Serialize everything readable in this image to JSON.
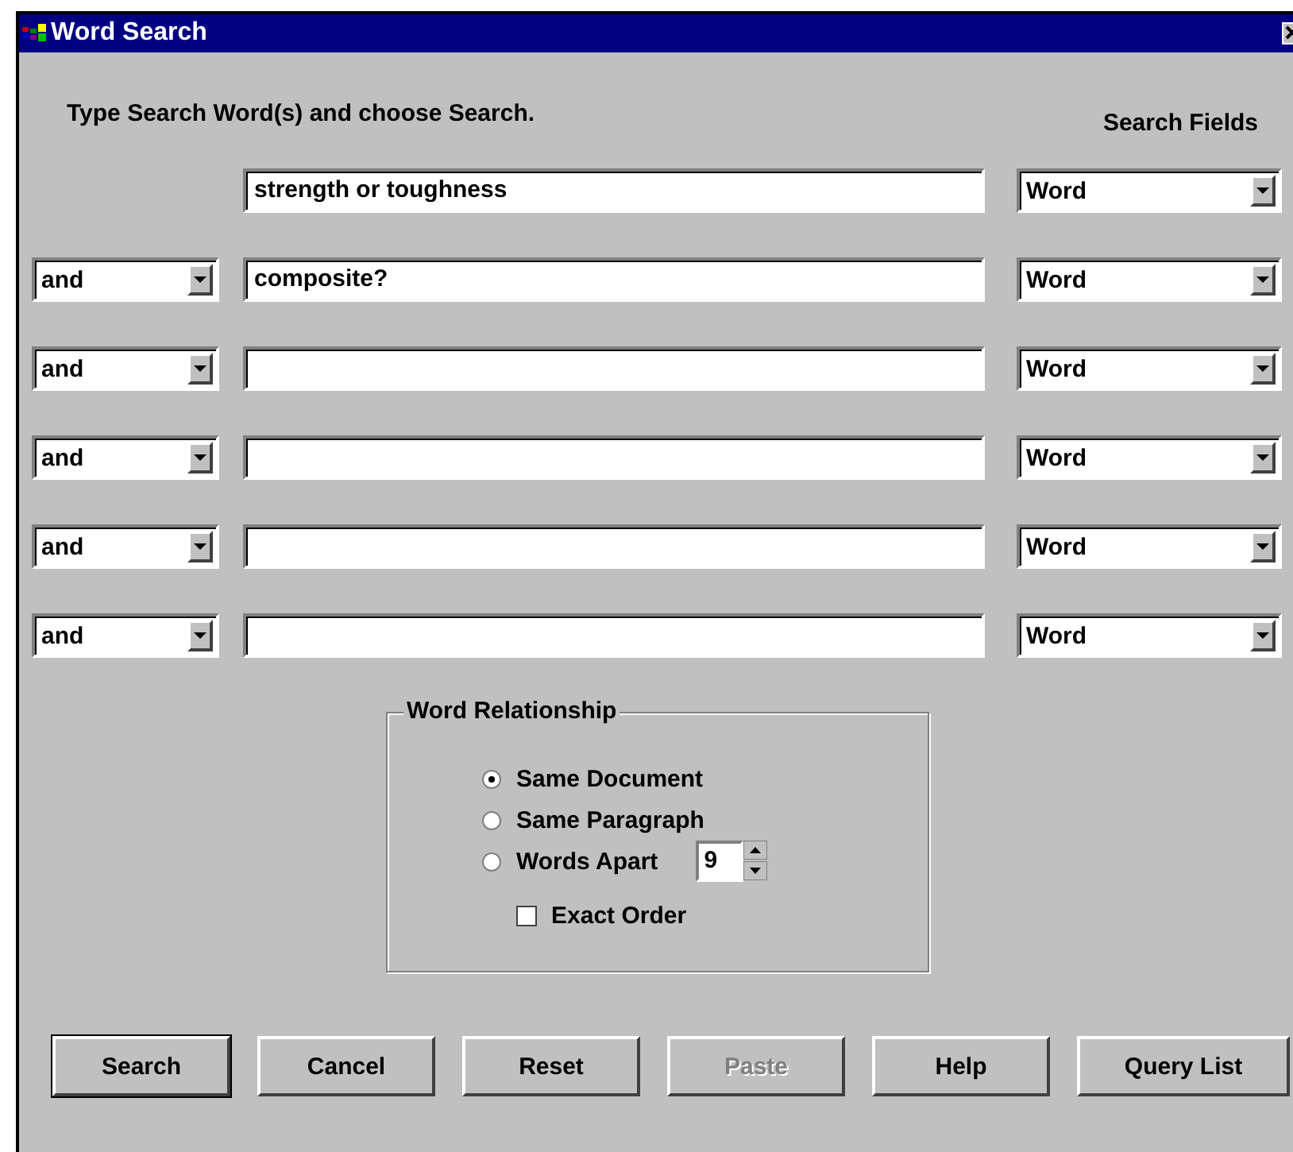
{
  "window": {
    "title": "Word Search"
  },
  "instructions": "Type Search Word(s) and choose Search.",
  "search_fields_header": {
    "label": "Search Fields"
  },
  "rows": [
    {
      "query": "strength or toughness",
      "field": "Word"
    },
    {
      "operator": "and",
      "query": "composite?",
      "field": "Word"
    },
    {
      "operator": "and",
      "query": "",
      "field": "Word"
    },
    {
      "operator": "and",
      "query": "",
      "field": "Word"
    },
    {
      "operator": "and",
      "query": "",
      "field": "Word"
    },
    {
      "operator": "and",
      "query": "",
      "field": "Word"
    }
  ],
  "relationship": {
    "title": "Word Relationship",
    "options": [
      {
        "label": "Same Document",
        "selected": true
      },
      {
        "label": "Same Paragraph",
        "selected": false
      },
      {
        "label": "Words Apart",
        "selected": false,
        "spinner_value": "9"
      }
    ],
    "exact_order": {
      "label": "Exact Order",
      "checked": false
    }
  },
  "buttons": [
    {
      "label": "Search",
      "default": true,
      "disabled": false
    },
    {
      "label": "Cancel",
      "default": false,
      "disabled": false
    },
    {
      "label": "Reset",
      "default": false,
      "disabled": false
    },
    {
      "label": "Paste",
      "default": false,
      "disabled": true
    },
    {
      "label": "Help",
      "default": false,
      "disabled": false
    },
    {
      "label": "Query List",
      "default": false,
      "disabled": false
    }
  ]
}
